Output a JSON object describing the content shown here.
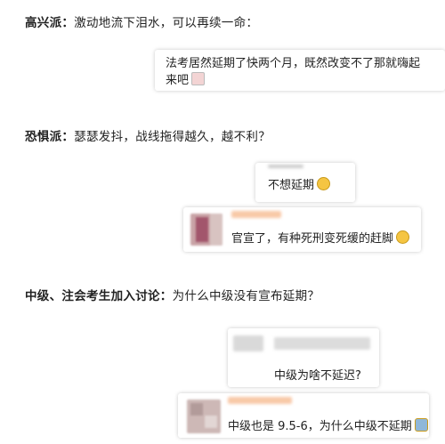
{
  "sections": [
    {
      "label": "高兴派：",
      "text": "激动地流下泪水，可以再续一命："
    },
    {
      "label": "恐惧派：",
      "text": "瑟瑟发抖，战线拖得越久，越不利？"
    },
    {
      "label": "中级、注会考生加入讨论：",
      "text": "为什么中级没有宣布延期？"
    }
  ],
  "comments": {
    "c1": {
      "line1": "法考居然延期了快两个月，既然改变不了那就嗨起",
      "line2": "来吧",
      "emoji": "smile-emoji-icon"
    },
    "c2": {
      "text": "不想延期",
      "emoji": "crying-emoji-icon"
    },
    "c3": {
      "text": "官宣了，有种死刑变死缓的赶脚",
      "emoji": "laughing-emoji-icon"
    },
    "c4": {
      "text": "中级为啥不延迟?"
    },
    "c5": {
      "text": "中级也是 9.5-6，为什么中级不延期",
      "emoji": "shrug-emoji-icon"
    }
  },
  "colors": {
    "text": "#222222",
    "card_bg": "#ffffff",
    "blur_name": "#f8c9a8",
    "blur_gray": "#d9d9d9"
  }
}
